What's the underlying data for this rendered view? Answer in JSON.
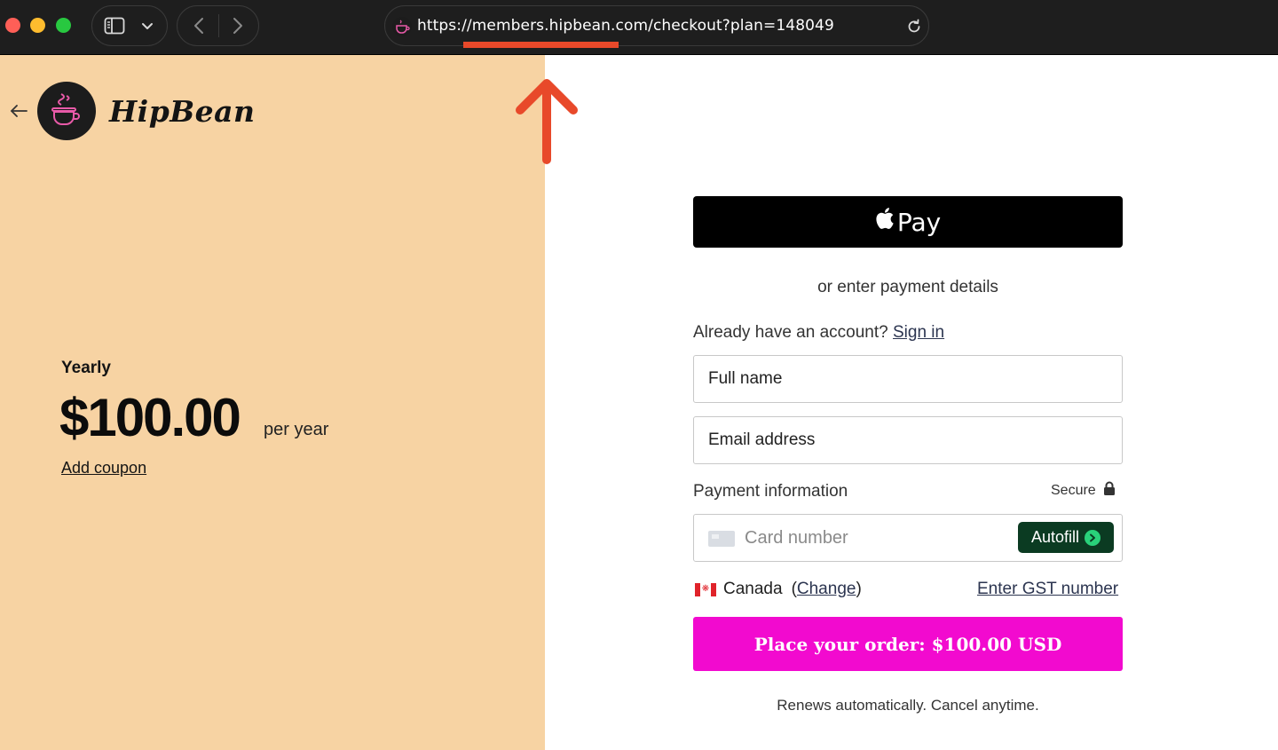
{
  "browser": {
    "url": "https://members.hipbean.com/checkout?plan=148049",
    "icons": {
      "sidebar": "sidebar-icon",
      "chevron": "chevron-down-icon",
      "back": "chevron-left-icon",
      "forward": "chevron-right-icon",
      "reload": "reload-icon",
      "favicon": "hipbean-favicon"
    },
    "traffic_colors": [
      "#ff5f57",
      "#febc2e",
      "#28c840"
    ]
  },
  "brand": {
    "name": "HipBean",
    "panel_color": "#f7d3a3"
  },
  "plan": {
    "name": "Yearly",
    "price": "$100.00",
    "period": "per year",
    "coupon_link": "Add coupon"
  },
  "checkout": {
    "apple_pay_label": "Pay",
    "or_text": "or enter payment details",
    "account_prompt": "Already have an account?",
    "sign_in_link": "Sign in",
    "full_name_placeholder": "Full name",
    "email_placeholder": "Email address",
    "payment_info_label": "Payment information",
    "secure_label": "Secure",
    "card_placeholder": "Card number",
    "autofill_label": "Autofill",
    "country": "Canada",
    "change_open": "(",
    "change_link": "Change",
    "change_close": ")",
    "gst_link": "Enter GST number",
    "order_button": "Place your order: $100.00 USD",
    "renews_text": "Renews automatically. Cancel anytime.",
    "accent_color": "#f20acf"
  },
  "annotation": {
    "color": "#e8492a"
  }
}
